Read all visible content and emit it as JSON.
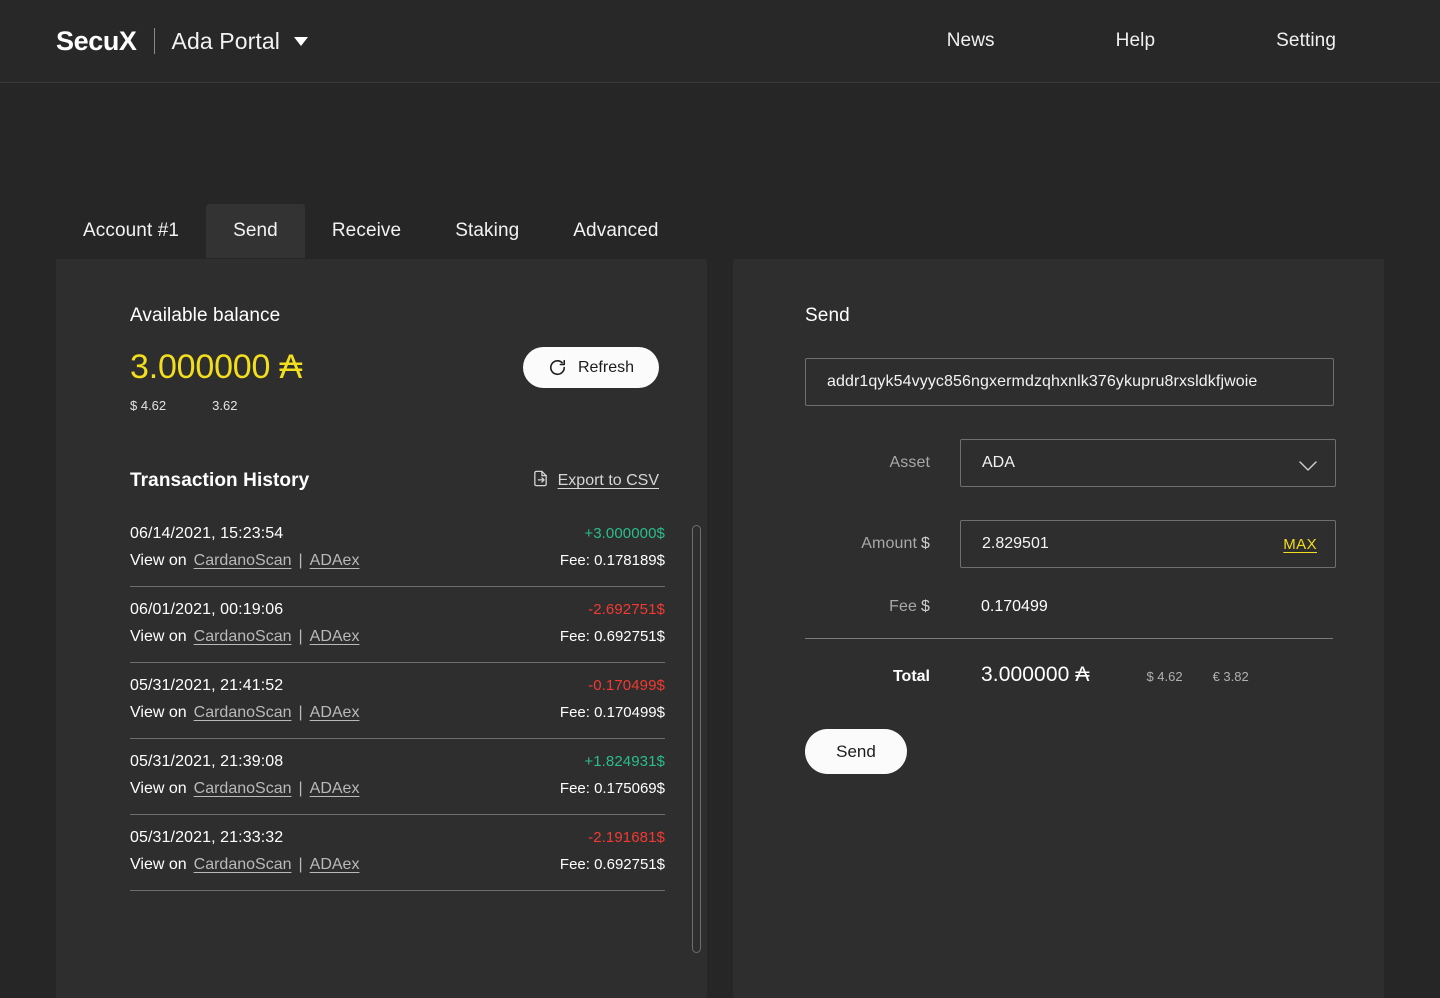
{
  "header": {
    "logo": "SecuX",
    "portal_name": "Ada Portal",
    "nav": [
      {
        "label": "News"
      },
      {
        "label": "Help"
      },
      {
        "label": "Setting"
      }
    ]
  },
  "tabs": [
    {
      "label": "Account #1",
      "active": false
    },
    {
      "label": "Send",
      "active": true
    },
    {
      "label": "Receive",
      "active": false
    },
    {
      "label": "Staking",
      "active": false
    },
    {
      "label": "Advanced",
      "active": false
    }
  ],
  "balance": {
    "label": "Available balance",
    "amount": "3.000000 ₳",
    "usd": "$ 4.62",
    "eur": "3.62",
    "refresh_label": "Refresh"
  },
  "transaction_history": {
    "title": "Transaction History",
    "export_label": "Export to CSV",
    "view_on_label": "View on",
    "link_primary": "CardanoScan",
    "link_separator": "|",
    "link_secondary": "ADAex",
    "rows": [
      {
        "date": "06/14/2021, 15:23:54",
        "amount": "+3.000000$",
        "direction": "positive",
        "fee": "Fee: 0.178189$"
      },
      {
        "date": "06/01/2021, 00:19:06",
        "amount": "-2.692751$",
        "direction": "negative",
        "fee": "Fee: 0.692751$"
      },
      {
        "date": "05/31/2021, 21:41:52",
        "amount": "-0.170499$",
        "direction": "negative",
        "fee": "Fee: 0.170499$"
      },
      {
        "date": "05/31/2021, 21:39:08",
        "amount": "+1.824931$",
        "direction": "positive",
        "fee": "Fee: 0.175069$"
      },
      {
        "date": "05/31/2021, 21:33:32",
        "amount": "-2.191681$",
        "direction": "negative",
        "fee": "Fee: 0.692751$"
      }
    ]
  },
  "send": {
    "title": "Send",
    "address_value": "addr1qyk54vyyc856ngxermdzqhxnlk376ykupru8rxsldkfjwoie",
    "asset_label": "Asset",
    "asset_value": "ADA",
    "amount_label": "Amount",
    "amount_currency": "$",
    "amount_value": "2.829501",
    "max_label": "MAX",
    "fee_label": "Fee",
    "fee_currency": "$",
    "fee_value": "0.170499",
    "total_label": "Total",
    "total_amount": "3.000000 ₳",
    "total_usd": "$ 4.62",
    "total_eur": "€ 3.82",
    "send_button": "Send"
  },
  "colors": {
    "accent_yellow": "#f2dd1e",
    "positive_green": "#2bbd8c",
    "negative_red": "#f23a32",
    "page_bg": "#262626",
    "panel_bg": "#2e2e2e",
    "header_bg": "#282828"
  }
}
